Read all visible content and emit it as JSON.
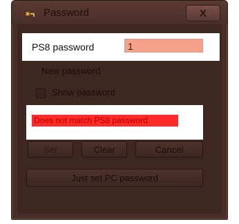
{
  "window": {
    "title": "Password",
    "close_glyph": "X",
    "app_icon": "key-icon"
  },
  "ps8": {
    "label": "PS8 password",
    "value": "1"
  },
  "new_password": {
    "label": "New password"
  },
  "show_password": {
    "label": "Show password",
    "checked": false
  },
  "error": {
    "text": "Does not match PS8 password",
    "color": "#ff2a2a"
  },
  "buttons": {
    "set_label": "Set",
    "clear_label": "Clear",
    "cancel_label": "Cancel",
    "just_set_label": "Just set PC password"
  },
  "colors": {
    "window_bg": "#4a2f29",
    "input_highlight": "#f5a28a"
  }
}
